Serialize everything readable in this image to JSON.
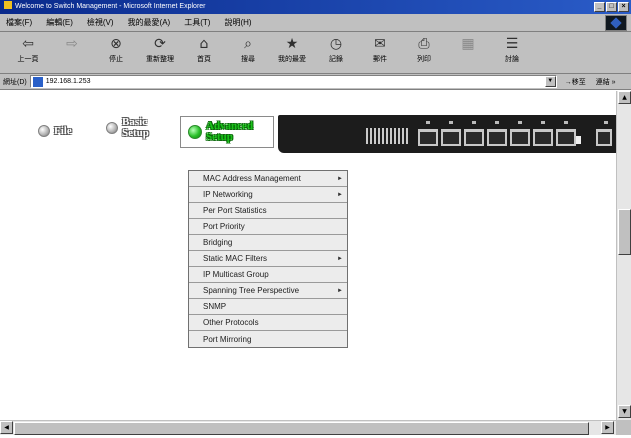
{
  "window": {
    "title": "Welcome to Switch Management - Microsoft Internet Explorer",
    "minimize_glyph": "_",
    "maximize_glyph": "□",
    "close_glyph": "×"
  },
  "menubar": [
    "檔案(F)",
    "編輯(E)",
    "檢視(V)",
    "我的最愛(A)",
    "工具(T)",
    "說明(H)"
  ],
  "toolbar": [
    {
      "label": "上一頁",
      "icon": "back-arrow-icon",
      "glyph": "⇦",
      "enabled": true
    },
    {
      "label": "",
      "icon": "forward-arrow-icon",
      "glyph": "⇨",
      "enabled": false
    },
    {
      "label": "停止",
      "icon": "stop-icon",
      "glyph": "⊗",
      "enabled": true
    },
    {
      "label": "重新整理",
      "icon": "refresh-icon",
      "glyph": "⟳",
      "enabled": true
    },
    {
      "label": "首頁",
      "icon": "home-icon",
      "glyph": "⌂",
      "enabled": true
    },
    {
      "label": "搜尋",
      "icon": "search-icon",
      "glyph": "⌕",
      "enabled": true
    },
    {
      "label": "我的最愛",
      "icon": "favorites-icon",
      "glyph": "★",
      "enabled": true
    },
    {
      "label": "記錄",
      "icon": "history-icon",
      "glyph": "◷",
      "enabled": true
    },
    {
      "label": "郵件",
      "icon": "mail-icon",
      "glyph": "✉",
      "enabled": true
    },
    {
      "label": "列印",
      "icon": "print-icon",
      "glyph": "⎙",
      "enabled": true
    },
    {
      "label": "",
      "icon": "edit-icon",
      "glyph": "▦",
      "enabled": false
    },
    {
      "label": "討論",
      "icon": "discuss-icon",
      "glyph": "☰",
      "enabled": true
    }
  ],
  "address": {
    "label": "網址(D)",
    "value": "192.168.1.253",
    "go": "→移至",
    "links": "連結 »"
  },
  "nav": {
    "file": "File",
    "basic_setup_line1": "Basic",
    "basic_setup_line2": "Setup",
    "advanced_setup_line1": "Advanced",
    "advanced_setup_line2": "Setup"
  },
  "colors": {
    "active_tab": "#19c319",
    "switch_body": "#1c1c1c",
    "menu_bg": "#ececec"
  },
  "menu": [
    {
      "label": "MAC Address Management",
      "submenu": true
    },
    {
      "label": "IP Networking",
      "submenu": true
    },
    {
      "label": "Per Port Statistics",
      "submenu": false
    },
    {
      "label": "Port Priority",
      "submenu": false
    },
    {
      "label": "Bridging",
      "submenu": false
    },
    {
      "label": "Static MAC Filters",
      "submenu": true
    },
    {
      "label": "IP Multicast Group",
      "submenu": false
    },
    {
      "label": "Spanning Tree Perspective",
      "submenu": true
    },
    {
      "label": "SNMP",
      "submenu": false
    },
    {
      "label": "Other Protocols",
      "submenu": false
    },
    {
      "label": "Port Mirroring",
      "submenu": false
    }
  ]
}
